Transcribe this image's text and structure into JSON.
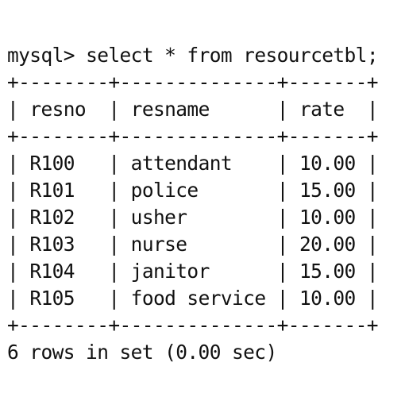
{
  "prompt": "mysql>",
  "command": "select * from resourcetbl;",
  "border": "+--------+--------------+-------+",
  "header": {
    "resno": "resno",
    "resname": "resname",
    "rate": "rate"
  },
  "rows": [
    {
      "resno": "R100",
      "resname": "attendant",
      "rate": "10.00"
    },
    {
      "resno": "R101",
      "resname": "police",
      "rate": "15.00"
    },
    {
      "resno": "R102",
      "resname": "usher",
      "rate": "10.00"
    },
    {
      "resno": "R103",
      "resname": "nurse",
      "rate": "20.00"
    },
    {
      "resno": "R104",
      "resname": "janitor",
      "rate": "15.00"
    },
    {
      "resno": "R105",
      "resname": "food service",
      "rate": "10.00"
    }
  ],
  "footer": "6 rows in set (0.00 sec)"
}
